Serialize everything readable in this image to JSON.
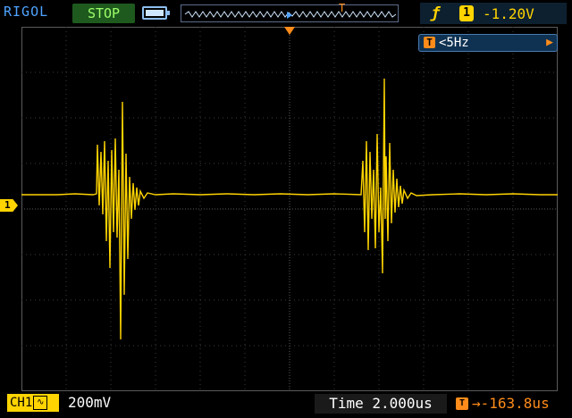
{
  "header": {
    "brand": "RIGOL",
    "run_status": "STOP",
    "trigger_slope_icon": "rising-edge-icon",
    "trigger_source": "1",
    "trigger_level": "-1.20V",
    "memory_marker": "T"
  },
  "screen": {
    "freq_counter_icon": "T",
    "freq_counter_value": "<5Hz",
    "freq_counter_arrow": "▶",
    "ch1_marker": "1"
  },
  "status": {
    "ch1_label": "CH1",
    "ch1_coupling": "∿",
    "volts_div": "200mV",
    "timebase": "Time 2.000us",
    "offset_icon": "T",
    "offset_value": "→-163.8us"
  },
  "colors": {
    "trace": "#ffd400",
    "grid": "#5c5c5c",
    "accent": "#ff8c1a",
    "brand": "#4fa3ff"
  }
}
